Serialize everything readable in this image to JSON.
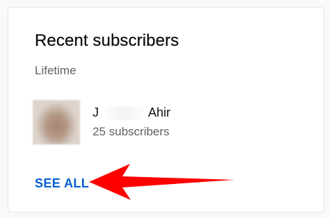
{
  "card": {
    "title": "Recent subscribers",
    "subtitle": "Lifetime"
  },
  "subscriber": {
    "name_prefix": "J",
    "name_suffix": "Ahir",
    "count_text": "25 subscribers"
  },
  "actions": {
    "see_all_label": "SEE ALL"
  },
  "colors": {
    "link": "#065fd4",
    "annotation_arrow": "#ff0000",
    "primary_text": "#0f0f0f",
    "secondary_text": "#606060"
  }
}
